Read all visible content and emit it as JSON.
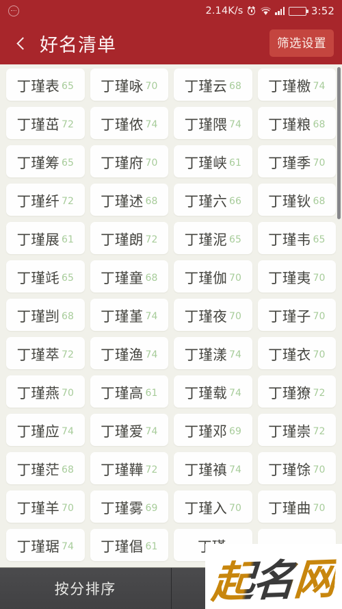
{
  "status_bar": {
    "left_icon": "more-circle-icon",
    "net_speed": "2.14K/s",
    "alarm_icon": "alarm-clock-icon",
    "wifi_icon": "wifi-icon",
    "signal_icon": "signal-bars-icon",
    "battery_icon": "battery-icon",
    "time": "3:52"
  },
  "header": {
    "back_icon": "chevron-left-icon",
    "title": "好名清单",
    "filter_button": "筛选设置",
    "bg_color": "#a8262b",
    "filter_btn_color": "#c4453f"
  },
  "list": {
    "columns": 4,
    "score_color": "#a7cc9a",
    "name_color": "#44443f",
    "card_color": "#fefefe",
    "items": [
      {
        "name": "丁瑾表",
        "score": "65"
      },
      {
        "name": "丁瑾咏",
        "score": "70"
      },
      {
        "name": "丁瑾云",
        "score": "68"
      },
      {
        "name": "丁瑾檄",
        "score": "74"
      },
      {
        "name": "丁瑾茁",
        "score": "72"
      },
      {
        "name": "丁瑾侬",
        "score": "74"
      },
      {
        "name": "丁瑾隈",
        "score": "74"
      },
      {
        "name": "丁瑾粮",
        "score": "68"
      },
      {
        "name": "丁瑾筹",
        "score": "65"
      },
      {
        "name": "丁瑾府",
        "score": "70"
      },
      {
        "name": "丁瑾峡",
        "score": "61"
      },
      {
        "name": "丁瑾季",
        "score": "70"
      },
      {
        "name": "丁瑾纤",
        "score": "72"
      },
      {
        "name": "丁瑾述",
        "score": "68"
      },
      {
        "name": "丁瑾六",
        "score": "66"
      },
      {
        "name": "丁瑾钬",
        "score": "68"
      },
      {
        "name": "丁瑾展",
        "score": "61"
      },
      {
        "name": "丁瑾朗",
        "score": "72"
      },
      {
        "name": "丁瑾泥",
        "score": "65"
      },
      {
        "name": "丁瑾韦",
        "score": "65"
      },
      {
        "name": "丁瑾竓",
        "score": "65"
      },
      {
        "name": "丁瑾童",
        "score": "68"
      },
      {
        "name": "丁瑾伽",
        "score": "70"
      },
      {
        "name": "丁瑾夷",
        "score": "70"
      },
      {
        "name": "丁瑾剀",
        "score": "68"
      },
      {
        "name": "丁瑾堇",
        "score": "74"
      },
      {
        "name": "丁瑾夜",
        "score": "70"
      },
      {
        "name": "丁瑾子",
        "score": "70"
      },
      {
        "name": "丁瑾萃",
        "score": "72"
      },
      {
        "name": "丁瑾渔",
        "score": "74"
      },
      {
        "name": "丁瑾漾",
        "score": "74"
      },
      {
        "name": "丁瑾衣",
        "score": "70"
      },
      {
        "name": "丁瑾燕",
        "score": "70"
      },
      {
        "name": "丁瑾高",
        "score": "61"
      },
      {
        "name": "丁瑾载",
        "score": "74"
      },
      {
        "name": "丁瑾獠",
        "score": "72"
      },
      {
        "name": "丁瑾应",
        "score": "74"
      },
      {
        "name": "丁瑾爱",
        "score": "74"
      },
      {
        "name": "丁瑾邓",
        "score": "69"
      },
      {
        "name": "丁瑾崇",
        "score": "72"
      },
      {
        "name": "丁瑾茫",
        "score": "68"
      },
      {
        "name": "丁瑾鞾",
        "score": "72"
      },
      {
        "name": "丁瑾禛",
        "score": "74"
      },
      {
        "name": "丁瑾馀",
        "score": "70"
      },
      {
        "name": "丁瑾羊",
        "score": "70"
      },
      {
        "name": "丁瑾雾",
        "score": "69"
      },
      {
        "name": "丁瑾入",
        "score": "70"
      },
      {
        "name": "丁瑾曲",
        "score": "70"
      },
      {
        "name": "丁瑾琚",
        "score": "74"
      },
      {
        "name": "丁瑾倡",
        "score": "61"
      },
      {
        "name": "丁瑾",
        "score": ""
      },
      {
        "name": "",
        "score": ""
      }
    ]
  },
  "bottom_bar": {
    "sort_label": "按分排序",
    "second_label": "",
    "bg_color": "#47474a"
  },
  "watermark": {
    "text": "起名网"
  }
}
